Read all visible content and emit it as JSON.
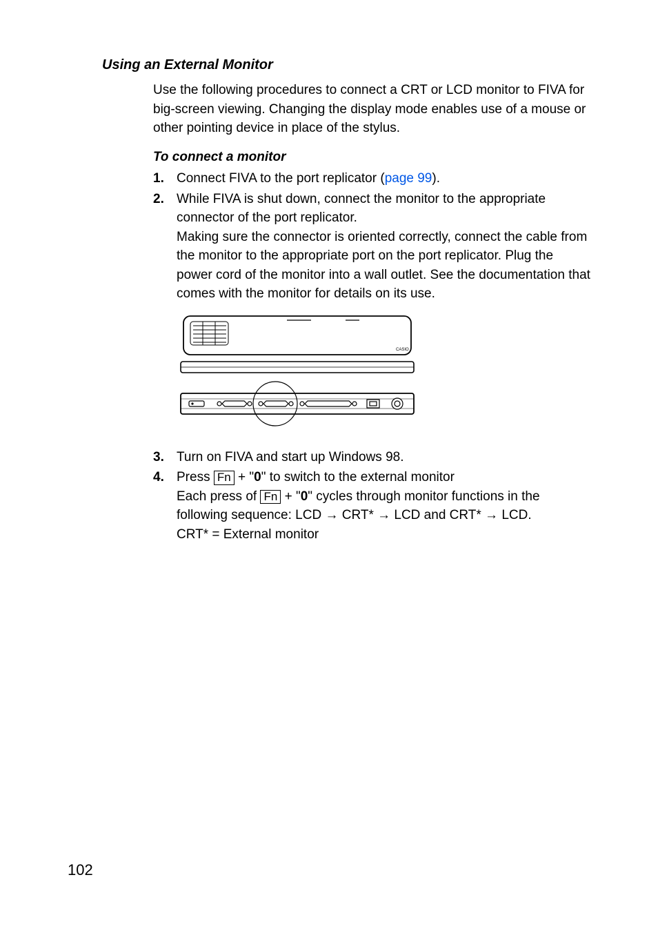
{
  "headings": {
    "section": "Using an External Monitor",
    "sub": "To connect a monitor"
  },
  "intro": "Use the following procedures to connect a CRT or LCD monitor to FIVA for big-screen viewing. Changing the display mode enables use of a mouse or other pointing device in place of the stylus.",
  "steps": {
    "s1": {
      "num": "1.",
      "pre": "Connect FIVA to the port replicator (",
      "link": "page 99",
      "post": ")."
    },
    "s2": {
      "num": "2.",
      "line1": "While FIVA is shut down, connect the monitor to the appropriate connector of the port replicator.",
      "line2": "Making sure the connector is oriented correctly, connect the cable from the monitor to the appropriate port on the port replicator. Plug the power cord of the monitor into a wall outlet. See the documentation that comes with the monitor for details on its use."
    },
    "s3": {
      "num": "3.",
      "text": "Turn on FIVA and start up Windows 98."
    },
    "s4": {
      "num": "4.",
      "t1": "Press ",
      "fn": "Fn",
      "t2": " + \"",
      "zero": "0",
      "t3": "\" to switch to the external monitor",
      "t4": "Each press of ",
      "t5": " + \"",
      "t6": "\" cycles through monitor functions in the following sequence: LCD → CRT* → LCD and CRT* → LCD.",
      "t7": "CRT* = External monitor"
    }
  },
  "pageNumber": "102"
}
